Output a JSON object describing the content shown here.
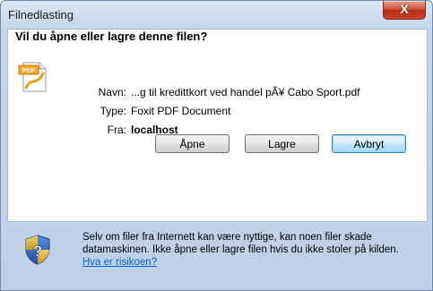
{
  "window": {
    "title": "Filnedlasting",
    "close_label": "X"
  },
  "dialog": {
    "question": "Vil du åpne eller lagre denne filen?",
    "file_icon": "pdf-file-icon",
    "name_label": "Navn:",
    "name_value": "...g til kredittkort ved handel pÃ¥ Cabo Sport.pdf",
    "type_label": "Type:",
    "type_value": "Foxit PDF Document",
    "from_label": "Fra:",
    "from_value": "localhost"
  },
  "buttons": {
    "open": "Åpne",
    "save": "Lagre",
    "cancel": "Avbryt"
  },
  "footer": {
    "shield_icon": "security-shield-icon",
    "warning_text": "Selv om filer fra Internett kan være nyttige, kan noen filer skade datamaskinen. Ikke åpne eller lagre filen hvis du ikke stoler på kilden.",
    "help_link": "Hva er risikoen?"
  },
  "colors": {
    "accent": "#3c7fb1",
    "link": "#0066cc",
    "close": "#c8442a"
  }
}
